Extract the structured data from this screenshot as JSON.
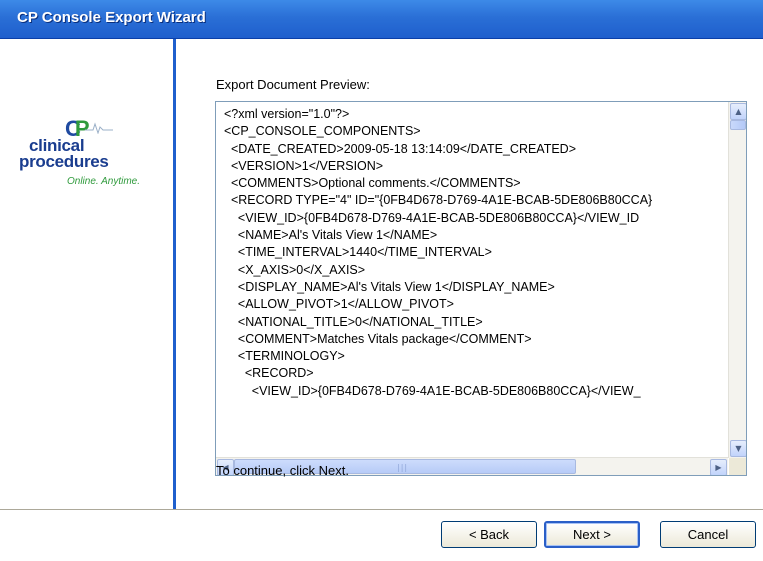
{
  "window": {
    "title": "CP Console Export Wizard"
  },
  "logo": {
    "line1": "clinical",
    "line2": "procedures",
    "tagline": "Online. Anytime."
  },
  "main": {
    "preview_label": "Export Document Preview:",
    "xml_lines": [
      "<?xml version=\"1.0\"?>",
      "<CP_CONSOLE_COMPONENTS>",
      "  <DATE_CREATED>2009-05-18 13:14:09</DATE_CREATED>",
      "  <VERSION>1</VERSION>",
      "  <COMMENTS>Optional comments.</COMMENTS>",
      "  <RECORD TYPE=\"4\" ID=\"{0FB4D678-D769-4A1E-BCAB-5DE806B80CCA}",
      "    <VIEW_ID>{0FB4D678-D769-4A1E-BCAB-5DE806B80CCA}</VIEW_ID",
      "    <NAME>Al's Vitals View 1</NAME>",
      "    <TIME_INTERVAL>1440</TIME_INTERVAL>",
      "    <X_AXIS>0</X_AXIS>",
      "    <DISPLAY_NAME>Al's Vitals View 1</DISPLAY_NAME>",
      "    <ALLOW_PIVOT>1</ALLOW_PIVOT>",
      "    <NATIONAL_TITLE>0</NATIONAL_TITLE>",
      "    <COMMENT>Matches Vitals package</COMMENT>",
      "    <TERMINOLOGY>",
      "      <RECORD>",
      "        <VIEW_ID>{0FB4D678-D769-4A1E-BCAB-5DE806B80CCA}</VIEW_"
    ],
    "continue_text": "To continue, click Next."
  },
  "buttons": {
    "back": "< Back",
    "next": "Next >",
    "cancel": "Cancel"
  },
  "icons": {
    "scroll_up": "scroll-up-arrow-icon",
    "scroll_down": "scroll-down-arrow-icon",
    "scroll_left": "scroll-left-arrow-icon",
    "scroll_right": "scroll-right-arrow-icon"
  },
  "colors": {
    "titlebar": "#2a6fd6",
    "sidebar_divider": "#1f5fcd",
    "logo_blue": "#1a3d8f",
    "logo_green": "#2f9a3c"
  }
}
